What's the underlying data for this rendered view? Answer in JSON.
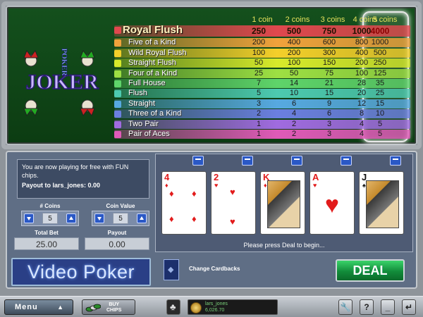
{
  "logo": {
    "text": "JOKER",
    "subtext": "POKER"
  },
  "paytable": {
    "coin_headers": [
      "1 coin",
      "2 coins",
      "3 coins",
      "4 coins",
      "5 coins"
    ],
    "selected_column": 5,
    "rows": [
      {
        "hand": "Royal Flush",
        "pays": [
          "250",
          "500",
          "750",
          "1000",
          "4000"
        ],
        "color": "#e0484e"
      },
      {
        "hand": "Five of a Kind",
        "pays": [
          "200",
          "400",
          "600",
          "800",
          "1000"
        ],
        "color": "#f0a23c"
      },
      {
        "hand": "Wild Royal Flush",
        "pays": [
          "100",
          "200",
          "300",
          "400",
          "500"
        ],
        "color": "#f4cf2a"
      },
      {
        "hand": "Straight Flush",
        "pays": [
          "50",
          "100",
          "150",
          "200",
          "250"
        ],
        "color": "#d7ea2b"
      },
      {
        "hand": "Four of a Kind",
        "pays": [
          "25",
          "50",
          "75",
          "100",
          "125"
        ],
        "color": "#9ee043"
      },
      {
        "hand": "Full House",
        "pays": [
          "7",
          "14",
          "21",
          "28",
          "35"
        ],
        "color": "#5fd46a"
      },
      {
        "hand": "Flush",
        "pays": [
          "5",
          "10",
          "15",
          "20",
          "25"
        ],
        "color": "#4dcab0"
      },
      {
        "hand": "Straight",
        "pays": [
          "3",
          "6",
          "9",
          "12",
          "15"
        ],
        "color": "#57a9e0"
      },
      {
        "hand": "Three of a Kind",
        "pays": [
          "2",
          "4",
          "6",
          "8",
          "10"
        ],
        "color": "#6b7fe0"
      },
      {
        "hand": "Two Pair",
        "pays": [
          "1",
          "2",
          "3",
          "4",
          "5"
        ],
        "color": "#a06be0"
      },
      {
        "hand": "Pair of Aces",
        "pays": [
          "1",
          "2",
          "3",
          "4",
          "5"
        ],
        "color": "#e05ab8"
      }
    ]
  },
  "message": {
    "line1": "You are now playing for free with FUN chips.",
    "line2": "Payout to lars_jones: 0.00"
  },
  "coins": {
    "label": "# Coins",
    "value": "5"
  },
  "coin_value": {
    "label": "Coin Value",
    "value": "5"
  },
  "total_bet": {
    "label": "Total Bet",
    "value": "25.00"
  },
  "payout": {
    "label": "Payout",
    "value": "0.00"
  },
  "title": "Video Poker",
  "cards": [
    {
      "rank": "4",
      "suit": "♦",
      "color": "red",
      "kind": "number"
    },
    {
      "rank": "2",
      "suit": "♥",
      "color": "red",
      "kind": "number"
    },
    {
      "rank": "K",
      "suit": "♦",
      "color": "red",
      "kind": "face"
    },
    {
      "rank": "A",
      "suit": "♥",
      "color": "red",
      "kind": "ace"
    },
    {
      "rank": "J",
      "suit": "♠",
      "color": "black",
      "kind": "face"
    }
  ],
  "deal_prompt": "Please press Deal to begin...",
  "change_cardbacks": "Change Cardbacks",
  "deal_button": "DEAL",
  "bottom_bar": {
    "menu": "Menu",
    "buy_chips": "BUY\nCHIPS",
    "player_name": "lars_jones",
    "credits": "6,026.70",
    "tools": [
      "wrench-icon",
      "help-icon",
      "minimize-icon",
      "back-icon"
    ]
  }
}
